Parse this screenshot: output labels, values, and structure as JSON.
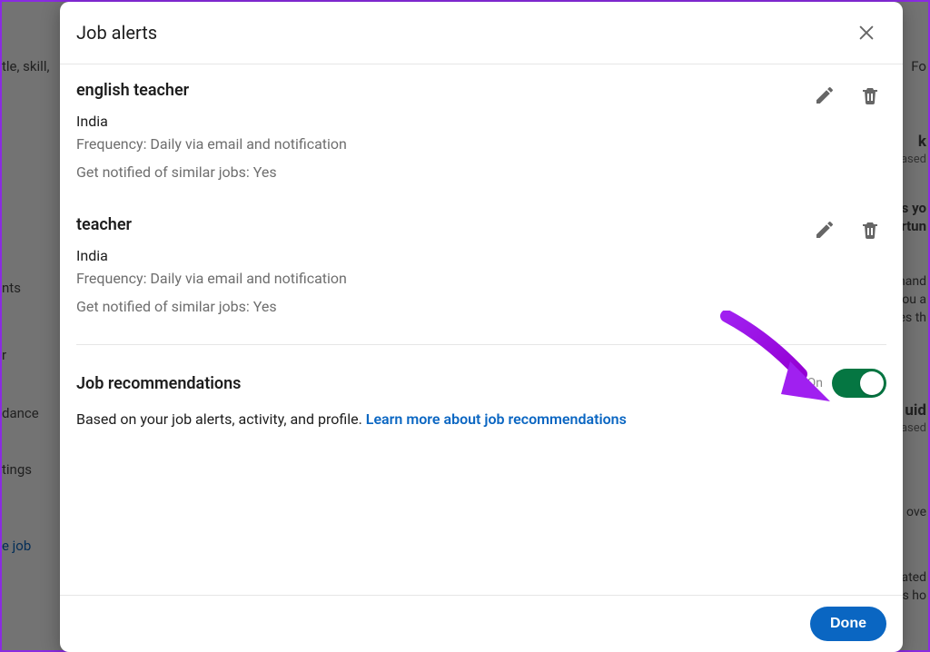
{
  "header": {
    "title": "Job alerts"
  },
  "alerts": [
    {
      "title": "english teacher",
      "location": "India",
      "frequency": "Frequency: Daily via email and notification",
      "similar": "Get notified of similar jobs: Yes"
    },
    {
      "title": "teacher",
      "location": "India",
      "frequency": "Frequency: Daily via email and notification",
      "similar": "Get notified of similar jobs: Yes"
    }
  ],
  "recommendations": {
    "title": "Job recommendations",
    "toggle_state": "On",
    "desc": "Based on your job alerts, activity, and profile. ",
    "link": "Learn more about job recommendations"
  },
  "footer": {
    "done": "Done"
  },
  "bg": {
    "t0": "tle, skill,",
    "t1": "nts",
    "t2": "r",
    "t3": "dance",
    "t4": "tings",
    "t5": "e job",
    "r0": "Fo",
    "r1": "k",
    "r2": "ased",
    "r3": "s yo",
    "r4": "rtun",
    "r5": "hand",
    "r6": "ou a",
    "r7": "es th",
    "r8": "uid",
    "r9": "ased",
    "r10": "ove",
    "r11": "ated",
    "r12": "s ho"
  }
}
